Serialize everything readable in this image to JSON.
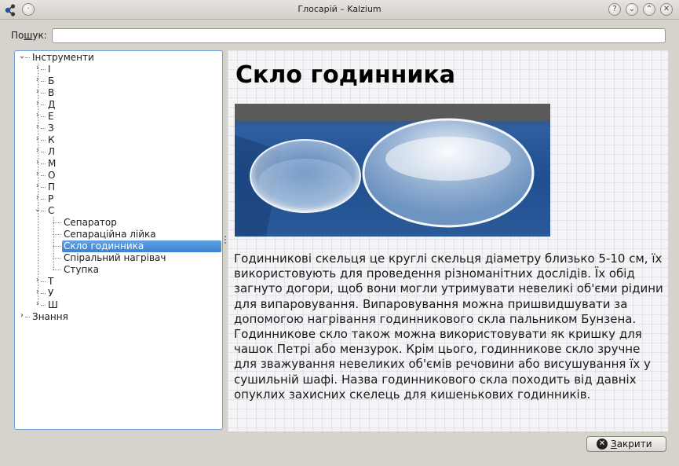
{
  "window": {
    "title": "Глосарій – Kalzium",
    "buttons": {
      "help": "?",
      "minimize": "⌄",
      "maximize": "⌃",
      "close": "✕"
    }
  },
  "search": {
    "label_pre": "По",
    "label_accel": "ш",
    "label_post": "ук:",
    "value": "",
    "placeholder": ""
  },
  "tree": {
    "root": "Інструменти",
    "letters_top": [
      "І",
      "Б",
      "В",
      "Д",
      "Е",
      "З",
      "К",
      "Л",
      "М",
      "О",
      "П",
      "Р"
    ],
    "expanded_letter": "С",
    "children": [
      "Сепаратор",
      "Сепараційна лійка",
      "Скло годинника",
      "Спіральний нагрівач",
      "Ступка"
    ],
    "selected_child_index": 2,
    "letters_bottom": [
      "Т",
      "У",
      "Ш"
    ],
    "second_root": "Знання"
  },
  "content": {
    "title": "Скло годинника",
    "image_alt": "watch-glass-photo",
    "description": "Годинникові скельця це круглі скельця діаметру близько 5-10 см, їх використовують для проведення різноманітних дослідів. Їх обід загнуто догори, щоб вони могли утримувати невеликі об'єми рідини для випаровування. Випаровування можна пришвидшувати за допомогою нагрівання годинникового скла пальником Бунзена. Годинникове скло також можна використовувати як кришку для чашок Петрі або мензурок. Крім цього, годинникове скло зручне для зважування невеликих об'ємів речовини або висушування їх у сушильній шафі. Назва годинникового скла походить від давніх опуклих захисних скелець для кишенькових годинників."
  },
  "footer": {
    "close_label_accel": "З",
    "close_label_rest": "акрити"
  },
  "colors": {
    "selection": "#3b82d0",
    "tree_border": "#6fa0d8",
    "window_bg": "#d6d2cc"
  }
}
